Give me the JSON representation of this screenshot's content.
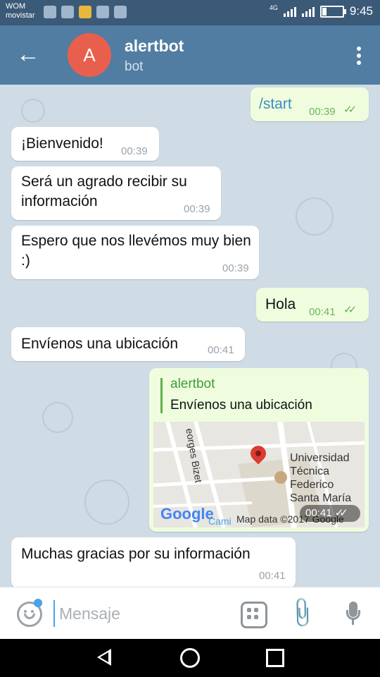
{
  "status_bar": {
    "carrier_line1": "WOM",
    "carrier_line2": "movistar",
    "network": "4G",
    "time": "9:45"
  },
  "header": {
    "avatar_letter": "A",
    "title": "alertbot",
    "subtitle": "bot",
    "avatar_color": "#e8604d",
    "bar_color": "#517da2"
  },
  "messages": [
    {
      "dir": "out",
      "text": "/start",
      "time": "00:39",
      "read": true
    },
    {
      "dir": "in",
      "text": "¡Bienvenido!",
      "time": "00:39"
    },
    {
      "dir": "in",
      "text": "Será un agrado recibir su información",
      "time": "00:39"
    },
    {
      "dir": "in",
      "text": "Espero que nos llevémos muy bien :)",
      "time": "00:39"
    },
    {
      "dir": "out",
      "text": "Hola",
      "time": "00:41",
      "read": true
    },
    {
      "dir": "in",
      "text": "Envíenos una ubicación",
      "time": "00:41"
    },
    {
      "dir": "out",
      "type": "location",
      "reply_name": "alertbot",
      "reply_text": "Envíenos una ubicación",
      "time": "00:41",
      "read": true,
      "map": {
        "street": "eorges Bizet",
        "place_line1": "Universidad",
        "place_line2": "Técnica",
        "place_line3": "Federico",
        "place_line4": "Santa María",
        "partial": "Cami",
        "google": "Google",
        "attribution": "Map data ©2017 Google"
      }
    },
    {
      "dir": "in",
      "text": "Muchas gracias por su información",
      "time": "00:41"
    }
  ],
  "input": {
    "placeholder": "Mensaje"
  },
  "icons": {
    "back": "arrow-left-icon",
    "menu": "more-vertical-icon",
    "emoji": "smiley-icon",
    "stickers": "sticker-grid-icon",
    "attach": "paperclip-icon",
    "mic": "microphone-icon",
    "tick": "double-check-icon"
  }
}
